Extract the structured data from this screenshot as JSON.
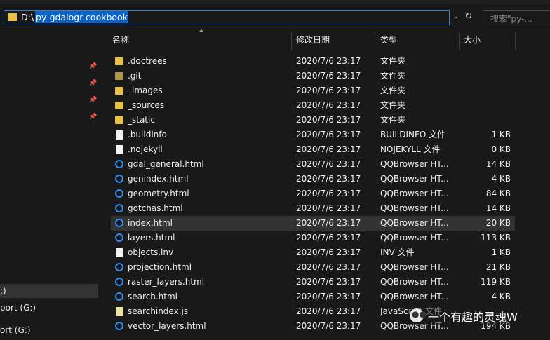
{
  "address": {
    "prefix": "D:\\",
    "selected": "py-gdalogr-cookbook"
  },
  "search": {
    "placeholder": "搜索\"py-..."
  },
  "header": {
    "name": "名称",
    "date": "修改日期",
    "type": "类型",
    "size": "大小"
  },
  "nav": {
    "items": [
      {
        "label": ":)",
        "selected": true
      },
      {
        "label": "port (G:)",
        "selected": false
      },
      {
        "label": "ort (G:)",
        "selected": false
      }
    ]
  },
  "files": [
    {
      "name": ".doctrees",
      "date": "2020/7/6 23:17",
      "type": "文件夹",
      "size": "",
      "icon": "folder-icon"
    },
    {
      "name": ".git",
      "date": "2020/7/6 23:17",
      "type": "文件夹",
      "size": "",
      "icon": "folder-dim-icon"
    },
    {
      "name": "_images",
      "date": "2020/7/6 23:17",
      "type": "文件夹",
      "size": "",
      "icon": "folder-icon"
    },
    {
      "name": "_sources",
      "date": "2020/7/6 23:17",
      "type": "文件夹",
      "size": "",
      "icon": "folder-icon"
    },
    {
      "name": "_static",
      "date": "2020/7/6 23:17",
      "type": "文件夹",
      "size": "",
      "icon": "folder-icon"
    },
    {
      "name": ".buildinfo",
      "date": "2020/7/6 23:17",
      "type": "BUILDINFO 文件",
      "size": "1 KB",
      "icon": "file-icon"
    },
    {
      "name": ".nojekyll",
      "date": "2020/7/6 23:17",
      "type": "NOJEKYLL 文件",
      "size": "0 KB",
      "icon": "file-icon"
    },
    {
      "name": "gdal_general.html",
      "date": "2020/7/6 23:17",
      "type": "QQBrowser HT...",
      "size": "14 KB",
      "icon": "qqbrowser-icon"
    },
    {
      "name": "genindex.html",
      "date": "2020/7/6 23:17",
      "type": "QQBrowser HT...",
      "size": "4 KB",
      "icon": "qqbrowser-icon"
    },
    {
      "name": "geometry.html",
      "date": "2020/7/6 23:17",
      "type": "QQBrowser HT...",
      "size": "84 KB",
      "icon": "qqbrowser-icon"
    },
    {
      "name": "gotchas.html",
      "date": "2020/7/6 23:17",
      "type": "QQBrowser HT...",
      "size": "14 KB",
      "icon": "qqbrowser-icon"
    },
    {
      "name": "index.html",
      "date": "2020/7/6 23:17",
      "type": "QQBrowser HT...",
      "size": "20 KB",
      "icon": "qqbrowser-icon",
      "selected": true
    },
    {
      "name": "layers.html",
      "date": "2020/7/6 23:17",
      "type": "QQBrowser HT...",
      "size": "113 KB",
      "icon": "qqbrowser-icon"
    },
    {
      "name": "objects.inv",
      "date": "2020/7/6 23:17",
      "type": "INV 文件",
      "size": "1 KB",
      "icon": "file-icon"
    },
    {
      "name": "projection.html",
      "date": "2020/7/6 23:17",
      "type": "QQBrowser HT...",
      "size": "21 KB",
      "icon": "qqbrowser-icon"
    },
    {
      "name": "raster_layers.html",
      "date": "2020/7/6 23:17",
      "type": "QQBrowser HT...",
      "size": "119 KB",
      "icon": "qqbrowser-icon"
    },
    {
      "name": "search.html",
      "date": "2020/7/6 23:17",
      "type": "QQBrowser HT...",
      "size": "4 KB",
      "icon": "qqbrowser-icon"
    },
    {
      "name": "searchindex.js",
      "date": "2020/7/6 23:17",
      "type": "JavaScript 文件",
      "size": "",
      "icon": "js-icon"
    },
    {
      "name": "vector_layers.html",
      "date": "2020/7/6 23:17",
      "type": "QQBrowser HT...",
      "size": "194 KB",
      "icon": "qqbrowser-icon"
    }
  ],
  "watermark": {
    "text": "一个有趣的灵魂W"
  },
  "colors": {
    "accent": "#0a63c9",
    "background": "#191919",
    "selected_row": "#333333",
    "folder": "#e8c14a"
  }
}
